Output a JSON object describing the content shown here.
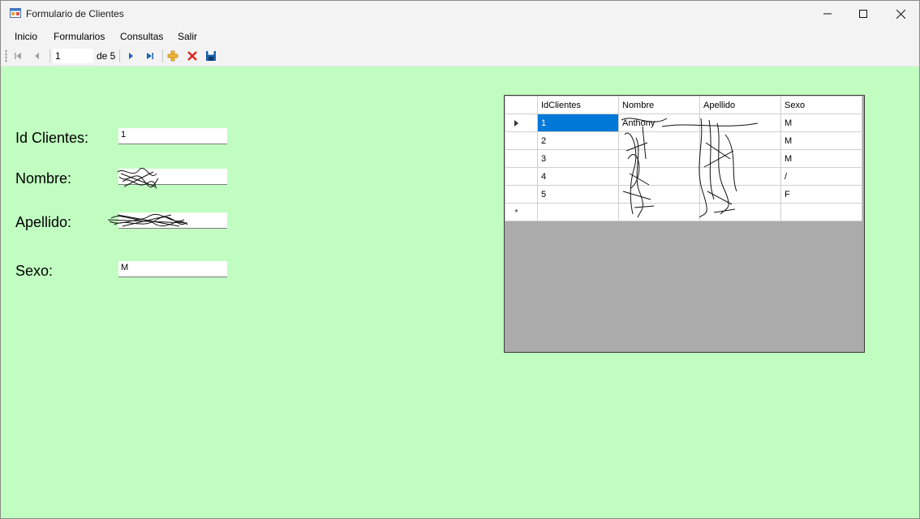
{
  "window": {
    "title": "Formulario de Clientes"
  },
  "menu": [
    "Inicio",
    "Formularios",
    "Consultas",
    "Salir"
  ],
  "navigator": {
    "position": "1",
    "count_label": "de 5"
  },
  "form": {
    "id_label": "Id Clientes:",
    "id_value": "1",
    "nombre_label": "Nombre:",
    "nombre_value": "",
    "apellido_label": "Apellido:",
    "apellido_value": "",
    "sexo_label": "Sexo:",
    "sexo_value": "M"
  },
  "grid": {
    "columns": [
      "IdClientes",
      "Nombre",
      "Apellido",
      "Sexo"
    ],
    "rows": [
      [
        "1",
        "Anthony",
        "",
        "M"
      ],
      [
        "2",
        "",
        "",
        "M"
      ],
      [
        "3",
        "",
        "",
        "M"
      ],
      [
        "4",
        "",
        "",
        "/"
      ],
      [
        "5",
        "",
        "",
        "F"
      ]
    ],
    "new_row_marker": "*"
  },
  "colors": {
    "form_background": "#c1fdc1",
    "selection": "#0078d7",
    "grid_background": "#ababab"
  }
}
